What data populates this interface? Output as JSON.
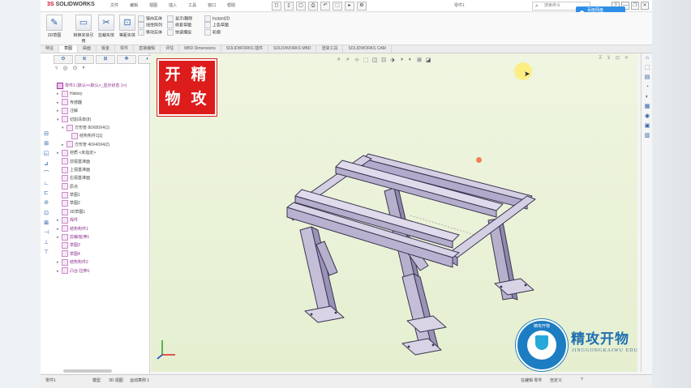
{
  "app": {
    "logo_mark": "3S",
    "logo_text": "SOLIDWORKS",
    "menus": [
      "文件",
      "编辑",
      "视图",
      "插入",
      "工具",
      "窗口",
      "帮助"
    ],
    "quick_access": [
      "◻",
      "▯",
      "▢",
      "⎙",
      "↶",
      "⬚",
      "▸",
      "⚙"
    ],
    "doc_title": "零件1",
    "search_placeholder": "搜索命令",
    "window_buttons": [
      "?",
      "—",
      "❐",
      "✕"
    ]
  },
  "overlay": {
    "baidu_label": "百度网盘"
  },
  "ribbon": {
    "big_buttons": [
      {
        "label": "3D草图",
        "icon": "✎"
      },
      {
        "label": "转换实体引用",
        "icon": "▭"
      },
      {
        "label": "剪裁实体",
        "icon": "✂"
      },
      {
        "label": "等距实体",
        "icon": "⊡"
      }
    ],
    "small_col1": [
      "镜向实体",
      "线性阵列",
      "移动实体"
    ],
    "small_col2": [
      "显示/删除",
      "修复草图",
      "快速捕捉"
    ],
    "small_col3": [
      "Instant2D",
      "上色草图",
      "轮廓"
    ]
  },
  "command_tabs": [
    "特征",
    "草图",
    "曲面",
    "钣金",
    "焊件",
    "直接编辑",
    "评估",
    "MBD Dimensions",
    "SOLIDWORKS 插件",
    "SOLIDWORKS MBD",
    "渲染工具",
    "SOLIDWORKS CAM"
  ],
  "command_tabs_active": 1,
  "feature_manager": {
    "tabs": [
      "⚙",
      "≣",
      "⊞",
      "✥",
      "◐"
    ],
    "tools": [
      "▿",
      "◎",
      "⊙",
      "◐"
    ],
    "tree": [
      {
        "label": "零件1 (默认<<默认>_显示状态 1>)",
        "level": 0,
        "twist": "",
        "purple": true,
        "root": true
      },
      {
        "label": "History",
        "level": 1,
        "twist": "▸",
        "purple": false
      },
      {
        "label": "传感器",
        "level": 1,
        "twist": "▸",
        "purple": false
      },
      {
        "label": "注解",
        "level": 1,
        "twist": "▸",
        "purple": false
      },
      {
        "label": "切割清单(8)",
        "level": 1,
        "twist": "▾",
        "purple": false
      },
      {
        "label": "方形管 80X80X4(1)",
        "level": 2,
        "twist": "▾",
        "purple": false
      },
      {
        "label": "结构构件1[1]",
        "level": 3,
        "twist": "",
        "purple": false
      },
      {
        "label": "方形管 40X40X4(2)",
        "level": 2,
        "twist": "▸",
        "purple": false
      },
      {
        "label": "材质 <未指定>",
        "level": 1,
        "twist": "▸",
        "purple": false
      },
      {
        "label": "前视基准面",
        "level": 1,
        "twist": "",
        "purple": false
      },
      {
        "label": "上视基准面",
        "level": 1,
        "twist": "",
        "purple": false
      },
      {
        "label": "右视基准面",
        "level": 1,
        "twist": "",
        "purple": false
      },
      {
        "label": "原点",
        "level": 1,
        "twist": "",
        "purple": false
      },
      {
        "label": "草图1",
        "level": 1,
        "twist": "",
        "purple": false
      },
      {
        "label": "草图2",
        "level": 1,
        "twist": "",
        "purple": false
      },
      {
        "label": "3D草图1",
        "level": 1,
        "twist": "",
        "purple": false
      },
      {
        "label": "焊件",
        "level": 1,
        "twist": "▸",
        "purple": true
      },
      {
        "label": "结构构件1",
        "level": 1,
        "twist": "▸",
        "purple": true
      },
      {
        "label": "剪裁/延伸1",
        "level": 1,
        "twist": "▸",
        "purple": true
      },
      {
        "label": "草图3",
        "level": 1,
        "twist": "",
        "purple": true
      },
      {
        "label": "草图4",
        "level": 1,
        "twist": "",
        "purple": true
      },
      {
        "label": "结构构件2",
        "level": 1,
        "twist": "▸",
        "purple": true
      },
      {
        "label": "凸台-拉伸1",
        "level": 1,
        "twist": "▸",
        "purple": true
      }
    ],
    "left_icons": [
      "⊟",
      "⊞",
      "◱",
      "⊿",
      "⌒",
      "∟",
      "⊏",
      "⊘",
      "⊡",
      "⊠",
      "⊣",
      "⊥",
      "⊤"
    ]
  },
  "viewport": {
    "hud_icons": [
      "⌕",
      "⌕",
      "⊹",
      "⬚",
      "◫",
      "⊡",
      "⬗",
      "◑",
      "◐",
      "⊞",
      "◪"
    ],
    "vtbar_icons": [
      "⊼",
      "⊻",
      "⊡",
      "✕"
    ],
    "seal_chars": [
      "精",
      "攻",
      "开",
      "物"
    ]
  },
  "brand": {
    "name": "精攻开物",
    "subtitle": "JINGGONGKAIWU EDU",
    "ring_text": "精攻开物"
  },
  "task_pane_icons": [
    "⌂",
    "⬚",
    "▤",
    "◔",
    "◐",
    "▦",
    "◉",
    "▣",
    "▥"
  ],
  "status": {
    "left": "零件1",
    "tab_model": "模型",
    "tab_3dviews": "3D 视图",
    "tab_motion": "运动算例 1",
    "right_state": "在编辑 零件",
    "units": "自定义",
    "help": "?"
  },
  "colors": {
    "seal": "#dd1c1c",
    "brand_blue": "#1d7dc2",
    "viewport_bg": "#e8f1d6",
    "model_fill": "#c4bed8"
  }
}
